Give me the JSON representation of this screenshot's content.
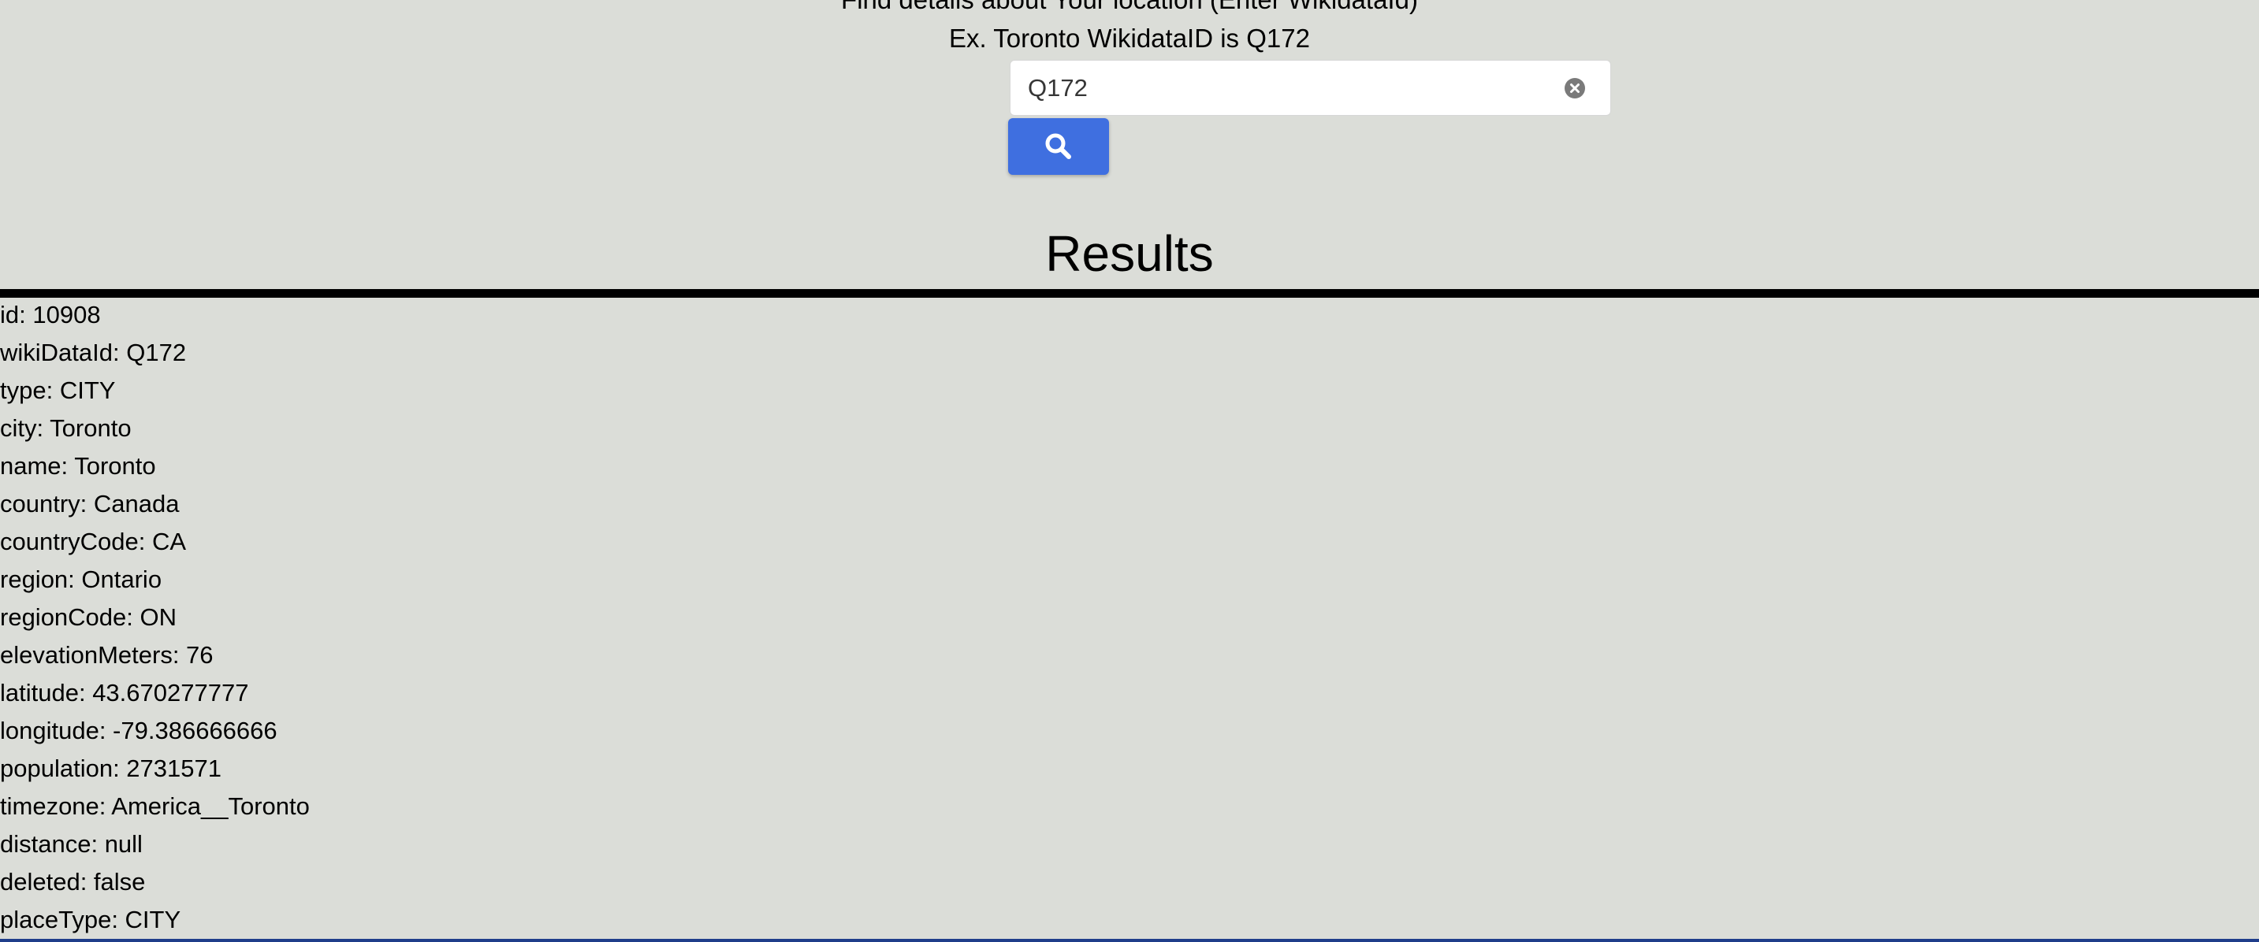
{
  "header": {
    "prompt": "Find details about Your location (Enter WikidataId)",
    "example": "Ex. Toronto WikidataID is Q172"
  },
  "search": {
    "value": "Q172",
    "placeholder": "",
    "clear_icon": "clear-circle-icon",
    "button_icon": "search-icon",
    "button_color": "#3f6fe0"
  },
  "results": {
    "title": "Results",
    "items": [
      "id: 10908",
      "wikiDataId: Q172",
      "type: CITY",
      "city: Toronto",
      "name: Toronto",
      "country: Canada",
      "countryCode: CA",
      "region: Ontario",
      "regionCode: ON",
      "elevationMeters: 76",
      "latitude: 43.670277777",
      "longitude: -79.386666666",
      "population: 2731571",
      "timezone: America__Toronto",
      "distance: null",
      "deleted: false",
      "placeType: CITY"
    ]
  },
  "colors": {
    "background": "#dbddd8",
    "accent": "#3f6fe0",
    "divider": "#000000"
  }
}
